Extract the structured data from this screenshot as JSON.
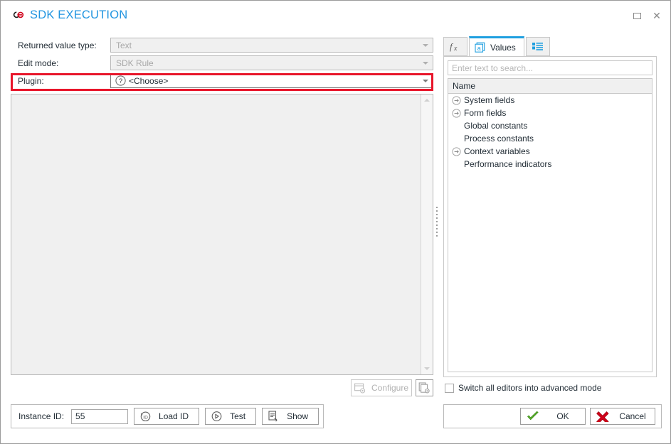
{
  "window": {
    "title": "SDK EXECUTION",
    "title_icon": "link-chain-icon",
    "title_color": "#2295e0",
    "maximize_label": "Maximize",
    "close_label": "Close"
  },
  "form": {
    "rows": [
      {
        "label": "Returned value type:",
        "value": "Text",
        "enabled": false,
        "icon": null
      },
      {
        "label": "Edit mode:",
        "value": "SDK Rule",
        "enabled": false,
        "icon": null
      },
      {
        "label": "Plugin:",
        "value": "<Choose>",
        "enabled": true,
        "icon": "question-mark-icon",
        "highlighted": true
      }
    ],
    "highlight_color": "#e8152a"
  },
  "editor": {
    "content": "",
    "scrollbar": {
      "up": "scroll-up",
      "down": "scroll-down"
    }
  },
  "configure": {
    "button_label": "Configure",
    "button_enabled": false,
    "icon": "window-gear-icon",
    "secondary_icon": "document-gear-icon"
  },
  "right_panel": {
    "tabs": [
      {
        "label": "",
        "icon": "function-fx-icon",
        "active": false
      },
      {
        "label": "Values",
        "icon": "values-card-icon",
        "active": true
      },
      {
        "label": "",
        "icon": "list-grid-icon",
        "active": false
      }
    ],
    "search": {
      "placeholder": "Enter text to search...",
      "value": ""
    },
    "grid": {
      "column_header": "Name",
      "items": [
        {
          "label": "System fields",
          "expandable": true
        },
        {
          "label": "Form fields",
          "expandable": true
        },
        {
          "label": "Global constants",
          "expandable": false
        },
        {
          "label": "Process constants",
          "expandable": false
        },
        {
          "label": "Context variables",
          "expandable": true
        },
        {
          "label": "Performance indicators",
          "expandable": false
        }
      ]
    }
  },
  "advanced": {
    "label": "Switch all editors into advanced mode",
    "checked": false
  },
  "bottom_bar": {
    "instance_label": "Instance ID:",
    "instance_value": "55",
    "buttons": [
      {
        "label": "Load ID",
        "icon": "load-id-icon"
      },
      {
        "label": "Test",
        "icon": "play-circle-icon"
      },
      {
        "label": "Show",
        "icon": "document-arrow-icon"
      }
    ]
  },
  "dialog_buttons": {
    "ok": {
      "label": "OK",
      "icon": "green-check-icon",
      "color": "#4caf2f"
    },
    "cancel": {
      "label": "Cancel",
      "icon": "red-cross-icon",
      "color": "#d0021b"
    }
  }
}
